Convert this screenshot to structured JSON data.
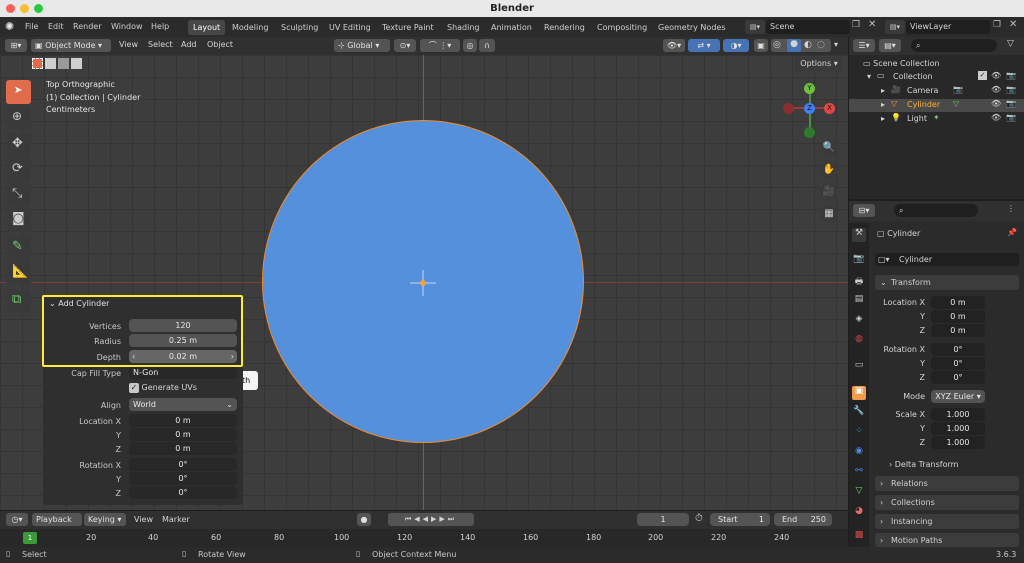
{
  "window": {
    "title": "Blender"
  },
  "menu": {
    "items": [
      "File",
      "Edit",
      "Render",
      "Window",
      "Help"
    ]
  },
  "workspaces": [
    "Layout",
    "Modeling",
    "Sculpting",
    "UV Editing",
    "Texture Paint",
    "Shading",
    "Animation",
    "Rendering",
    "Compositing",
    "Geometry Nodes"
  ],
  "scene": {
    "label": "Scene",
    "view_layer": "ViewLayer"
  },
  "header": {
    "mode": "Object Mode",
    "menus": [
      "View",
      "Select",
      "Add",
      "Object"
    ],
    "transform": "Global",
    "options": "Options"
  },
  "viewport": {
    "view_name": "Top Orthographic",
    "collection": "(1) Collection | Cylinder",
    "units": "Centimeters"
  },
  "gizmo": {
    "y": "Y",
    "x": "X",
    "z": "Z"
  },
  "operator_panel": {
    "title": "Add Cylinder",
    "vertices_label": "Vertices",
    "vertices": "120",
    "radius_label": "Radius",
    "radius": "0.25 m",
    "depth_label": "Depth",
    "depth": "0.02 m",
    "cap_fill_label": "Cap Fill Type",
    "cap_fill": "N-Gon",
    "generate_uvs": "Generate UVs",
    "align_label": "Align",
    "align": "World",
    "location_label": "Location X",
    "loc_x": "0 m",
    "loc_y": "0 m",
    "loc_z": "0 m",
    "rotation_label": "Rotation X",
    "rot_x": "0°",
    "rot_y": "0°",
    "rot_z": "0°",
    "y_label": "Y",
    "z_label": "Z"
  },
  "tooltip": "Depth",
  "timeline": {
    "playback": "Playback",
    "keying": "Keying",
    "view": "View",
    "marker": "Marker",
    "current_frame": "1",
    "start_label": "Start",
    "start": "1",
    "end_label": "End",
    "end": "250",
    "ticks": [
      "1",
      "20",
      "40",
      "60",
      "80",
      "100",
      "120",
      "140",
      "160",
      "180",
      "200",
      "220",
      "240"
    ]
  },
  "status": {
    "select": "Select",
    "rotate": "Rotate View",
    "context": "Object Context Menu",
    "version": "3.6.3"
  },
  "outliner": {
    "scene_collection": "Scene Collection",
    "items": [
      {
        "name": "Collection"
      },
      {
        "name": "Camera"
      },
      {
        "name": "Cylinder"
      },
      {
        "name": "Light"
      }
    ]
  },
  "properties": {
    "object_name": "Cylinder",
    "object_field": "Cylinder",
    "transform": "Transform",
    "location_x_label": "Location X",
    "loc_x": "0 m",
    "loc_y": "0 m",
    "loc_z": "0 m",
    "rotation_x_label": "Rotation X",
    "rot_x": "0°",
    "rot_y": "0°",
    "rot_z": "0°",
    "mode_label": "Mode",
    "mode": "XYZ Euler",
    "scale_x_label": "Scale X",
    "scale_x": "1.000",
    "scale_y": "1.000",
    "scale_z": "1.000",
    "y_label": "Y",
    "z_label": "Z",
    "delta_transform": "Delta Transform",
    "relations": "Relations",
    "collections": "Collections",
    "instancing": "Instancing",
    "motion_paths": "Motion Paths"
  },
  "colors": {
    "accent": "#4772b3",
    "cylinder_fill": "#5590dd",
    "highlight": "#ffeb3b",
    "selected": "#ffaf29"
  }
}
